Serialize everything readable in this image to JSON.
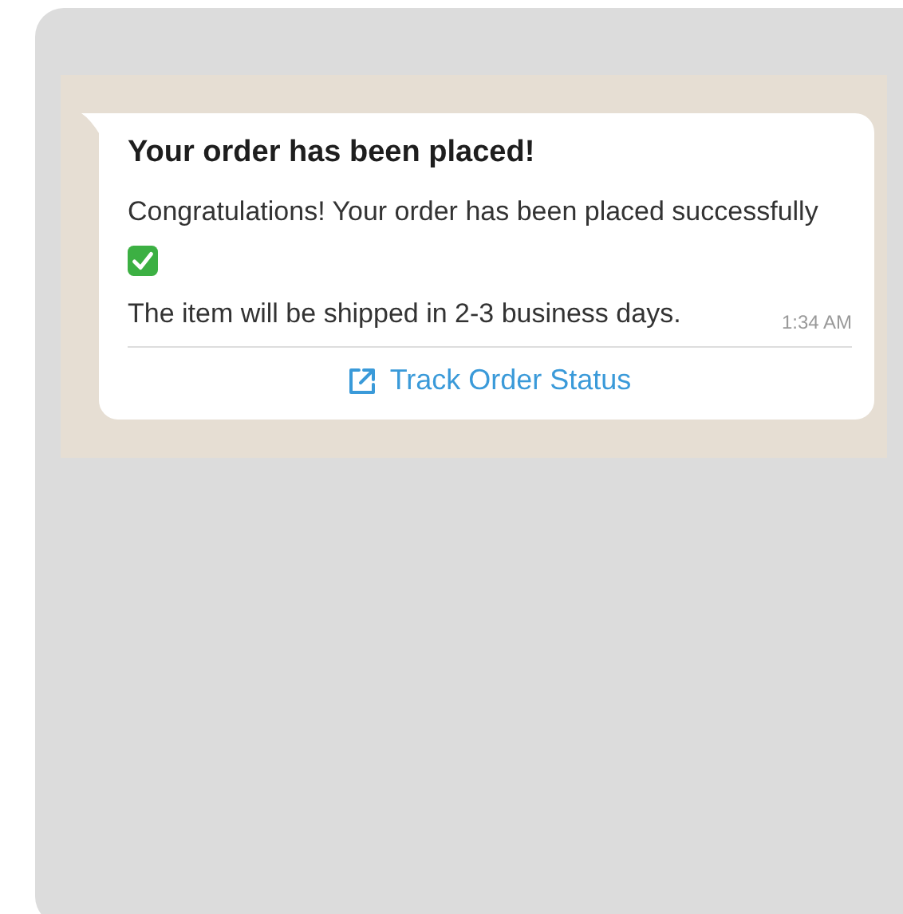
{
  "message": {
    "title": "Your order has been placed!",
    "lines": [
      "Congratulations! Your order has been placed successfully",
      "The item will be shipped in 2-3 business days."
    ],
    "time": "1:34 AM",
    "action": {
      "label": "Track Order Status"
    }
  }
}
